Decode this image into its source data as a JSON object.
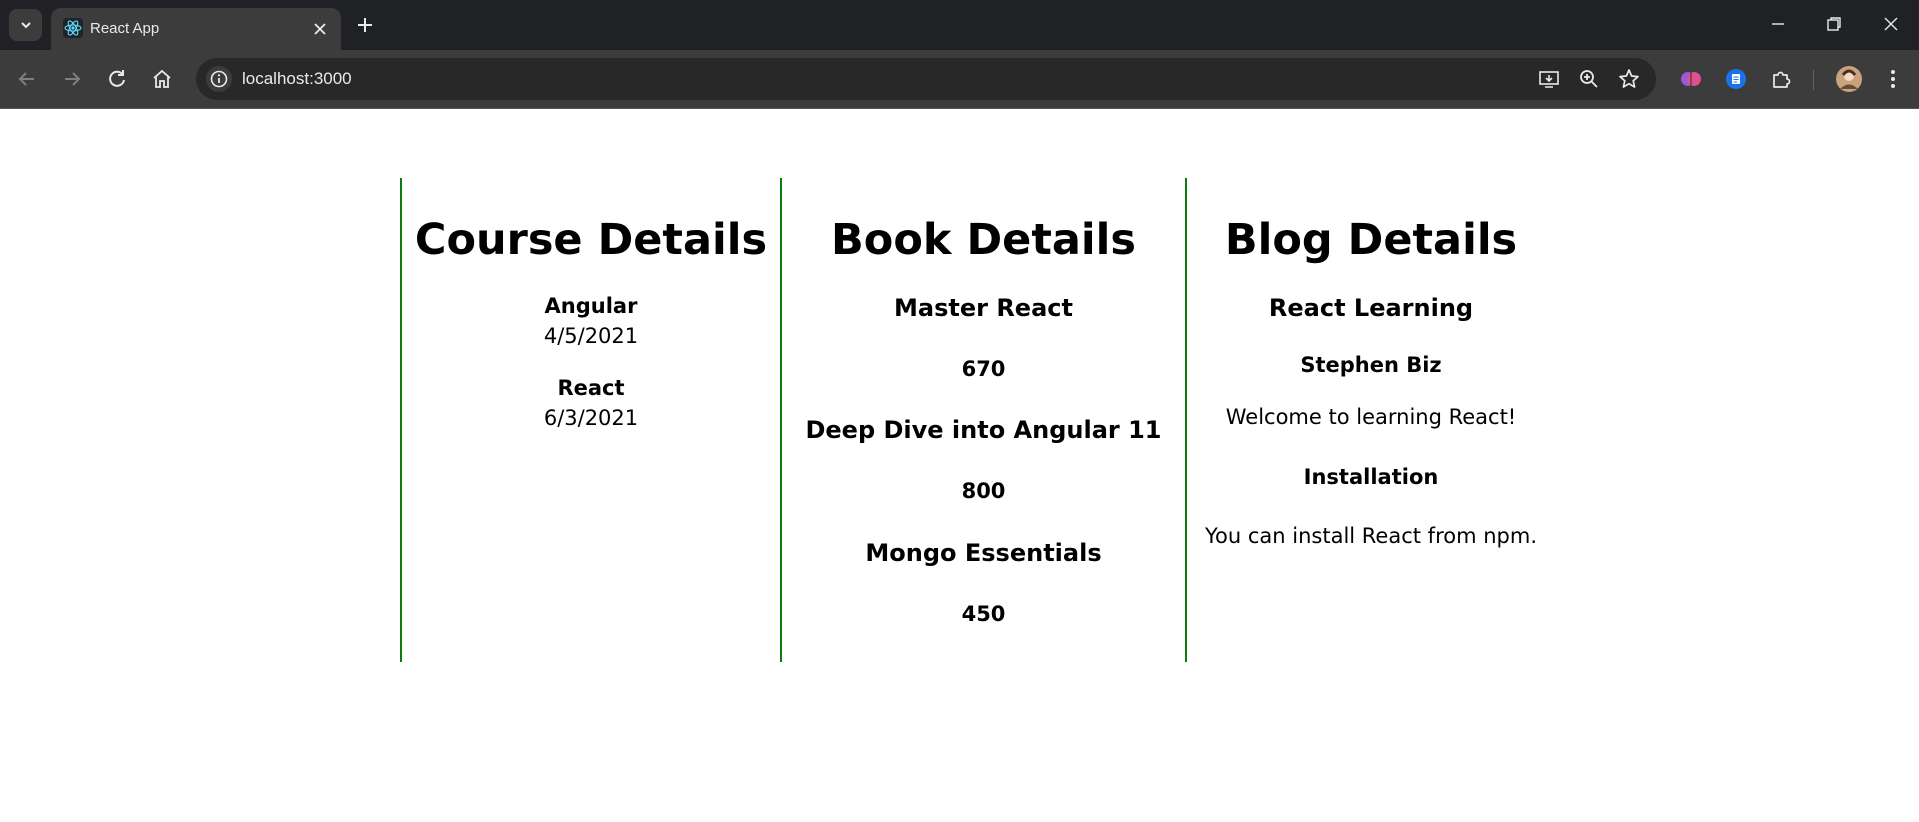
{
  "browser": {
    "tab_title": "React App",
    "url": "localhost:3000",
    "icons": {
      "tab_menu": "chevron-down-icon",
      "favicon": "react-logo-icon",
      "tab_close": "close-icon",
      "new_tab": "plus-icon",
      "back": "arrow-left-icon",
      "forward": "arrow-right-icon",
      "reload": "reload-icon",
      "home": "home-icon",
      "site_info": "info-icon",
      "install": "install-app-icon",
      "zoom": "zoom-icon",
      "bookmark": "star-icon",
      "extensions": "puzzle-icon",
      "menu": "kebab-menu-icon"
    }
  },
  "course": {
    "heading": "Course Details",
    "items": [
      {
        "name": "Angular",
        "date": "4/5/2021"
      },
      {
        "name": "React",
        "date": "6/3/2021"
      }
    ]
  },
  "book": {
    "heading": "Book Details",
    "items": [
      {
        "name": "Master React",
        "price": "670"
      },
      {
        "name": "Deep Dive into Angular 11",
        "price": "800"
      },
      {
        "name": "Mongo Essentials",
        "price": "450"
      }
    ]
  },
  "blog": {
    "heading": "Blog Details",
    "posts": [
      {
        "title": "React Learning",
        "author": "Stephen Biz",
        "content": "Welcome to learning React!"
      },
      {
        "title": "Installation",
        "content": "You can install React from npm."
      }
    ]
  },
  "colors": {
    "divider": "#0a7d0a",
    "chrome_dark": "#202124",
    "chrome_toolbar": "#3c3c3c"
  }
}
